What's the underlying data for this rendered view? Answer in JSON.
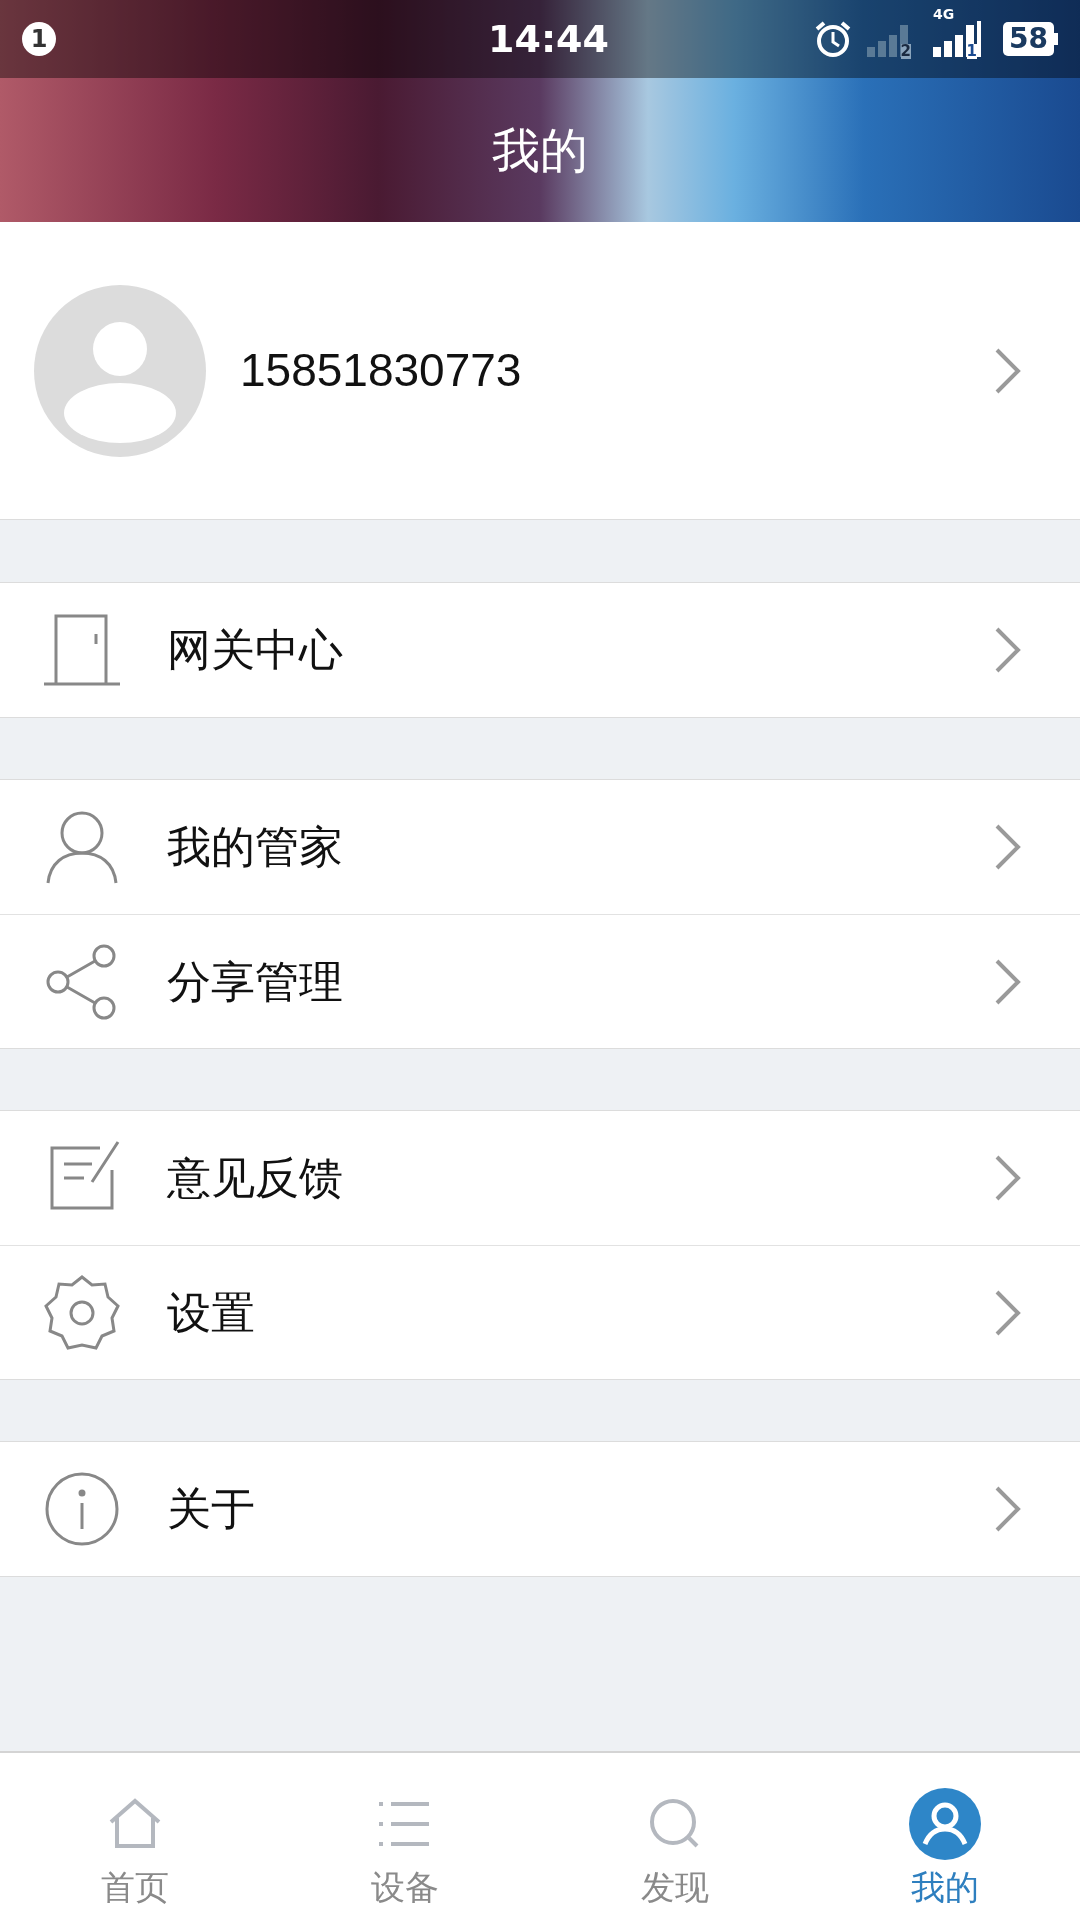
{
  "status_bar": {
    "notification_count": "1",
    "time": "14:44",
    "sim2_label": "2",
    "network_label": "4G",
    "sim1_label": "1",
    "battery": "58"
  },
  "header": {
    "title": "我的"
  },
  "profile": {
    "phone": "15851830773"
  },
  "groups": [
    [
      {
        "kind": "gateway",
        "label": "网关中心"
      }
    ],
    [
      {
        "kind": "person",
        "label": "我的管家"
      },
      {
        "kind": "share",
        "label": "分享管理"
      }
    ],
    [
      {
        "kind": "feedback",
        "label": "意见反馈"
      },
      {
        "kind": "settings",
        "label": "设置"
      }
    ],
    [
      {
        "kind": "info",
        "label": "关于"
      }
    ]
  ],
  "tabs": [
    {
      "kind": "home",
      "label": "首页",
      "selected": false
    },
    {
      "kind": "list",
      "label": "设备",
      "selected": false
    },
    {
      "kind": "search",
      "label": "发现",
      "selected": false
    },
    {
      "kind": "me",
      "label": "我的",
      "selected": true
    }
  ]
}
